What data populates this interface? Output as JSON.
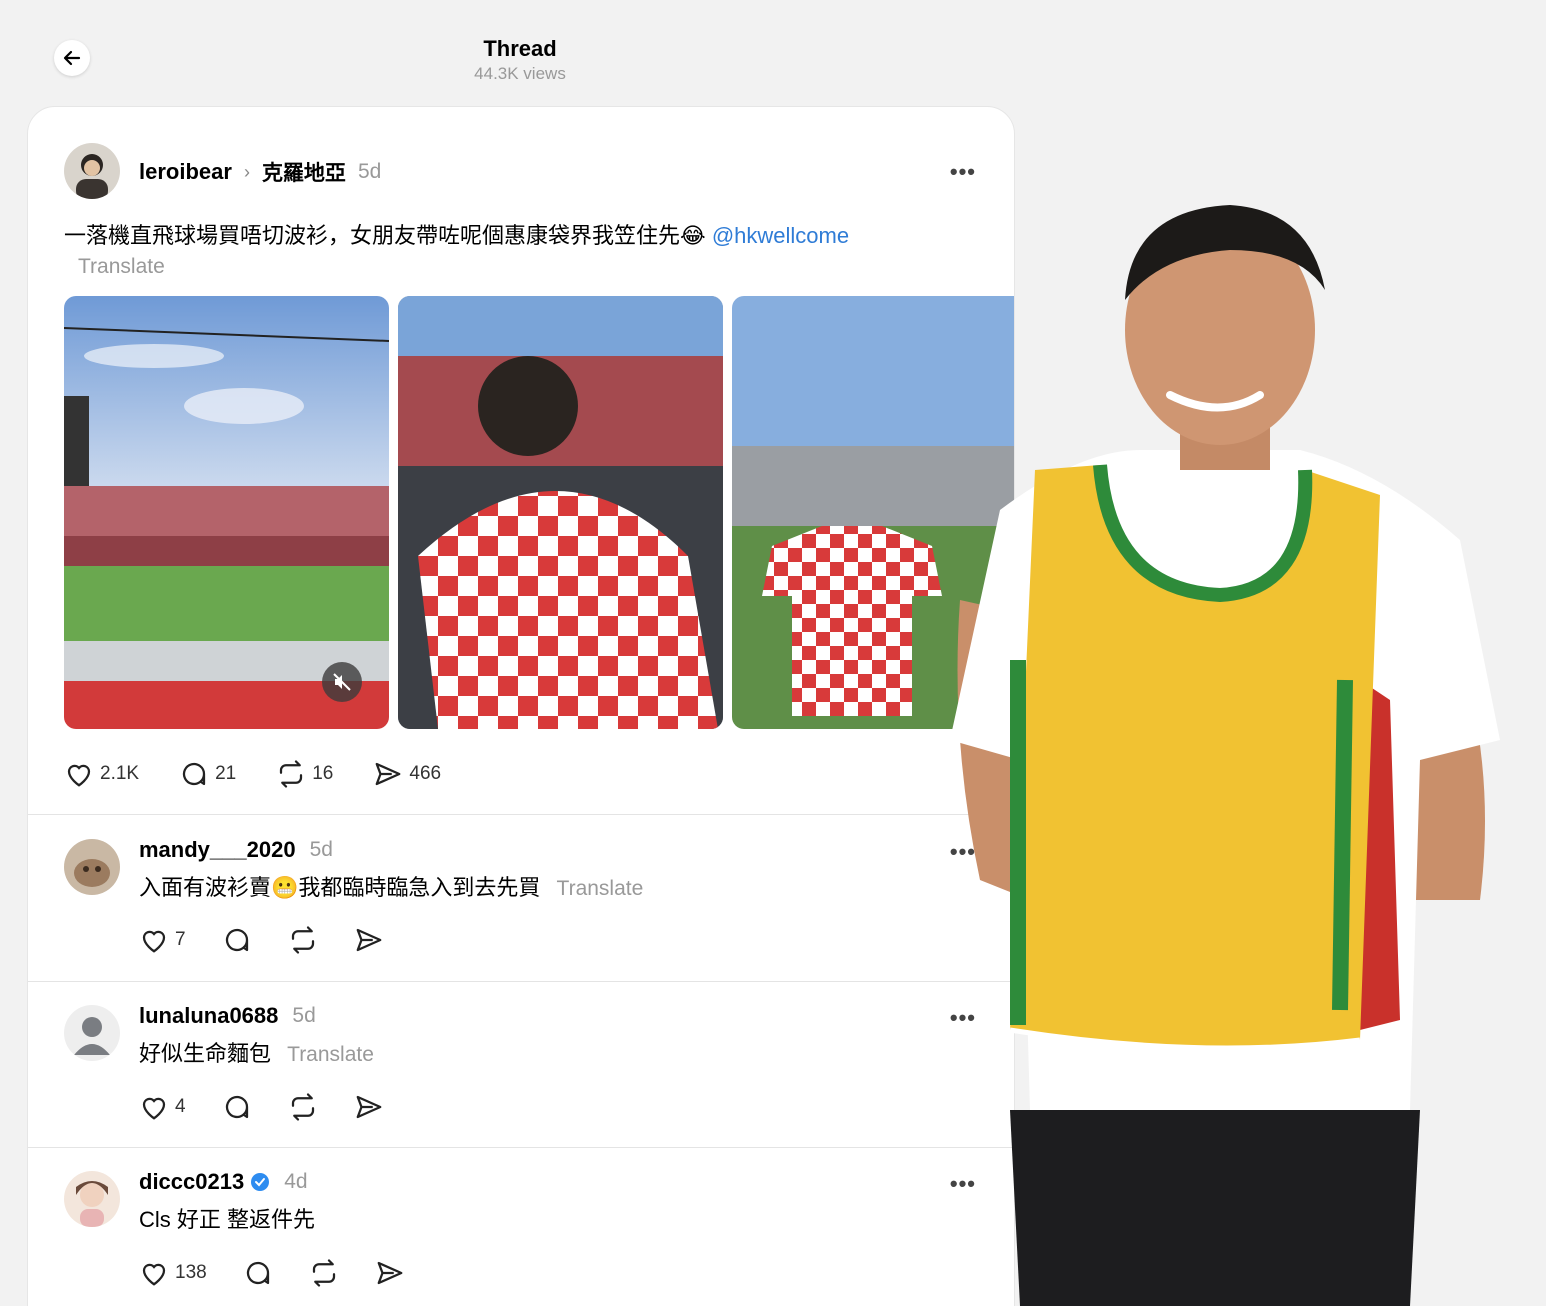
{
  "header": {
    "title": "Thread",
    "views": "44.3K views"
  },
  "post": {
    "username": "leroibear",
    "topic": "克羅地亞",
    "time": "5d",
    "text": "一落機直飛球場買唔切波衫，女朋友帶咗呢個惠康袋界我笠住先😂",
    "mention": "@hkwellcome",
    "translate": "Translate",
    "likes": "2.1K",
    "replies": "21",
    "reposts": "16",
    "shares": "466"
  },
  "replies": [
    {
      "username": "mandy___2020",
      "time": "5d",
      "text": "入面有波衫賣😬我都臨時臨急入到去先買",
      "translate": "Translate",
      "likes": "7"
    },
    {
      "username": "lunaluna0688",
      "time": "5d",
      "text": "好似生命麵包",
      "translate": "Translate",
      "likes": "4"
    },
    {
      "username": "diccc0213",
      "time": "4d",
      "text": "Cls 好正 整返件先",
      "translate": "",
      "likes": "138",
      "verified": true
    }
  ],
  "colors": {
    "link": "#2f7cd6",
    "verified": "#2e8cf0",
    "vest_yellow": "#f1c232",
    "vest_green": "#2e8b3a",
    "vest_red": "#c9312b"
  }
}
